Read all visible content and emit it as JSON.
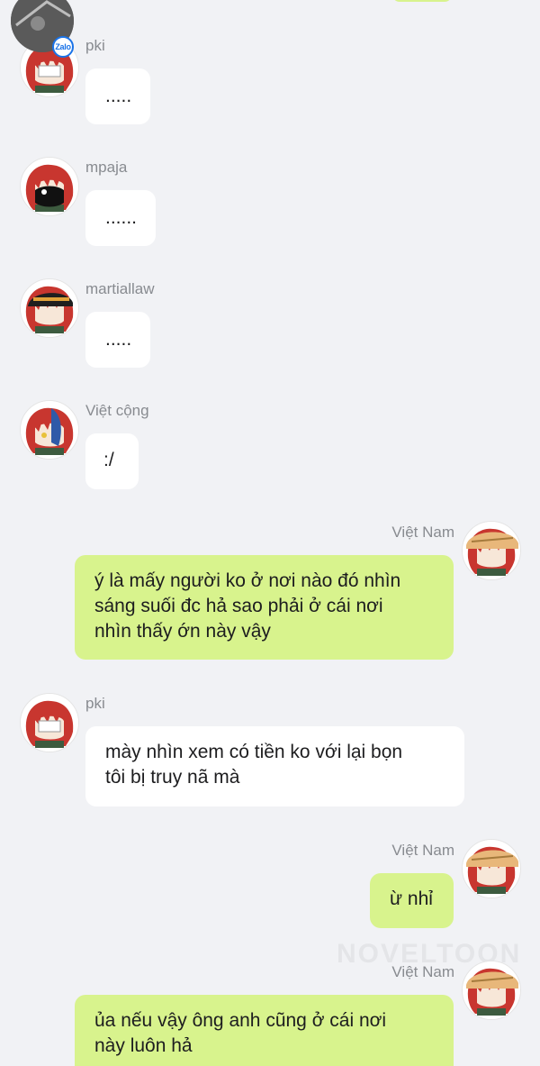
{
  "watermark": "NOVELTOON",
  "zalo_badge": "Zalo",
  "messages": [
    {
      "sender": "pki",
      "text": ".....",
      "direction": "in",
      "avatar": "red-hair-white-mask-avatar"
    },
    {
      "sender": "mpaja",
      "text": "......",
      "direction": "in",
      "avatar": "red-hair-black-mask-avatar"
    },
    {
      "sender": "martiallaw",
      "text": ".....",
      "direction": "in",
      "avatar": "red-hair-black-cap-avatar"
    },
    {
      "sender": "Việt cộng",
      "text": ":/",
      "direction": "in",
      "avatar": "red-blue-hair-avatar"
    },
    {
      "sender": "Việt Nam",
      "text": "ý là mấy người ko ở nơi nào đó nhìn sáng suối đc hả sao phải ở cái nơi nhìn thấy ớn này vậy",
      "lines": [
        "ý là mấy người ko ở nơi nào đó nhìn",
        "sáng suối đc hả sao phải ở cái nơi",
        "nhìn thấy ớn này vậy"
      ],
      "direction": "out",
      "avatar": "red-hair-straw-hat-avatar"
    },
    {
      "sender": "pki",
      "text": "mày nhìn xem có tiền ko với lại bọn tôi bị truy nã mà",
      "lines": [
        "mày nhìn xem có tiền ko với lại bọn",
        "tôi bị truy nã mà"
      ],
      "direction": "in",
      "avatar": "red-hair-white-mask-avatar"
    },
    {
      "sender": "Việt Nam",
      "text": "ừ nhỉ",
      "direction": "out",
      "avatar": "red-hair-straw-hat-avatar"
    },
    {
      "sender": "Việt Nam",
      "text": "ủa nếu vậy ông anh cũng ở cái nơi này luôn hả",
      "lines": [
        "ủa nếu vậy ông anh cũng ở cái nơi",
        "này luôn hả"
      ],
      "direction": "out",
      "avatar": "red-hair-straw-hat-avatar"
    }
  ],
  "colors": {
    "background": "#f1f2f5",
    "incoming_bubble": "#ffffff",
    "outgoing_bubble": "#d8f38d",
    "sender_text": "#888b90",
    "zalo_blue": "#1a73e8"
  }
}
